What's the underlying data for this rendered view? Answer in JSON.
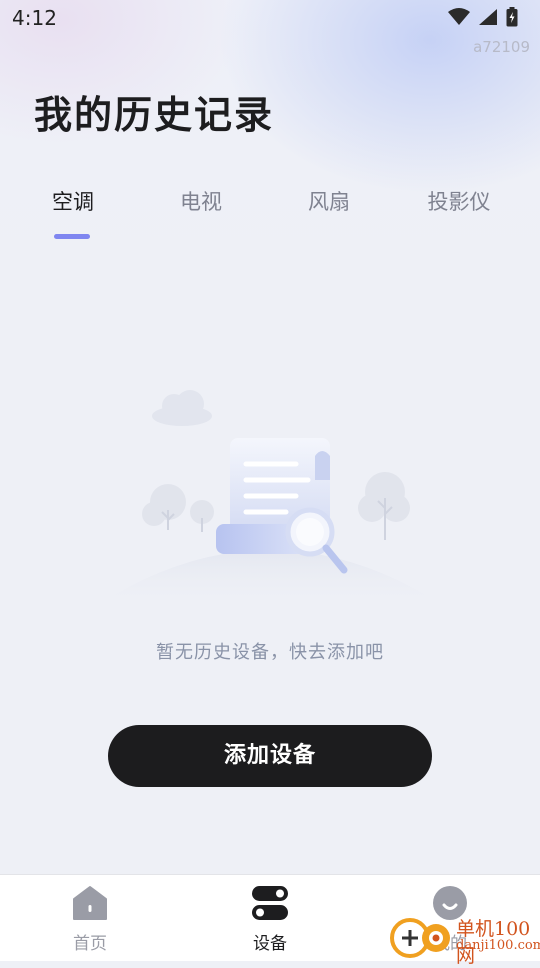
{
  "status_bar": {
    "time": "4:12"
  },
  "watermark_id": "a72109",
  "page": {
    "title": "我的历史记录"
  },
  "tabs": [
    {
      "label": "空调",
      "active": true
    },
    {
      "label": "电视",
      "active": false
    },
    {
      "label": "风扇",
      "active": false
    },
    {
      "label": "投影仪",
      "active": false
    }
  ],
  "empty_state": {
    "message": "暂无历史设备，快去添加吧",
    "illustration_icon": "document-search-icon"
  },
  "add_button": {
    "label": "添加设备"
  },
  "bottom_nav": [
    {
      "label": "首页",
      "icon": "home-icon",
      "active": false
    },
    {
      "label": "设备",
      "icon": "device-toggle-icon",
      "active": true
    },
    {
      "label": "我的",
      "icon": "profile-icon",
      "active": false
    }
  ],
  "brand_watermark": {
    "name": "单机100网",
    "url": "danji100.com"
  },
  "colors": {
    "accent": "#7f86f0",
    "button_bg": "#1c1c1e",
    "brand": "#d2541e"
  }
}
